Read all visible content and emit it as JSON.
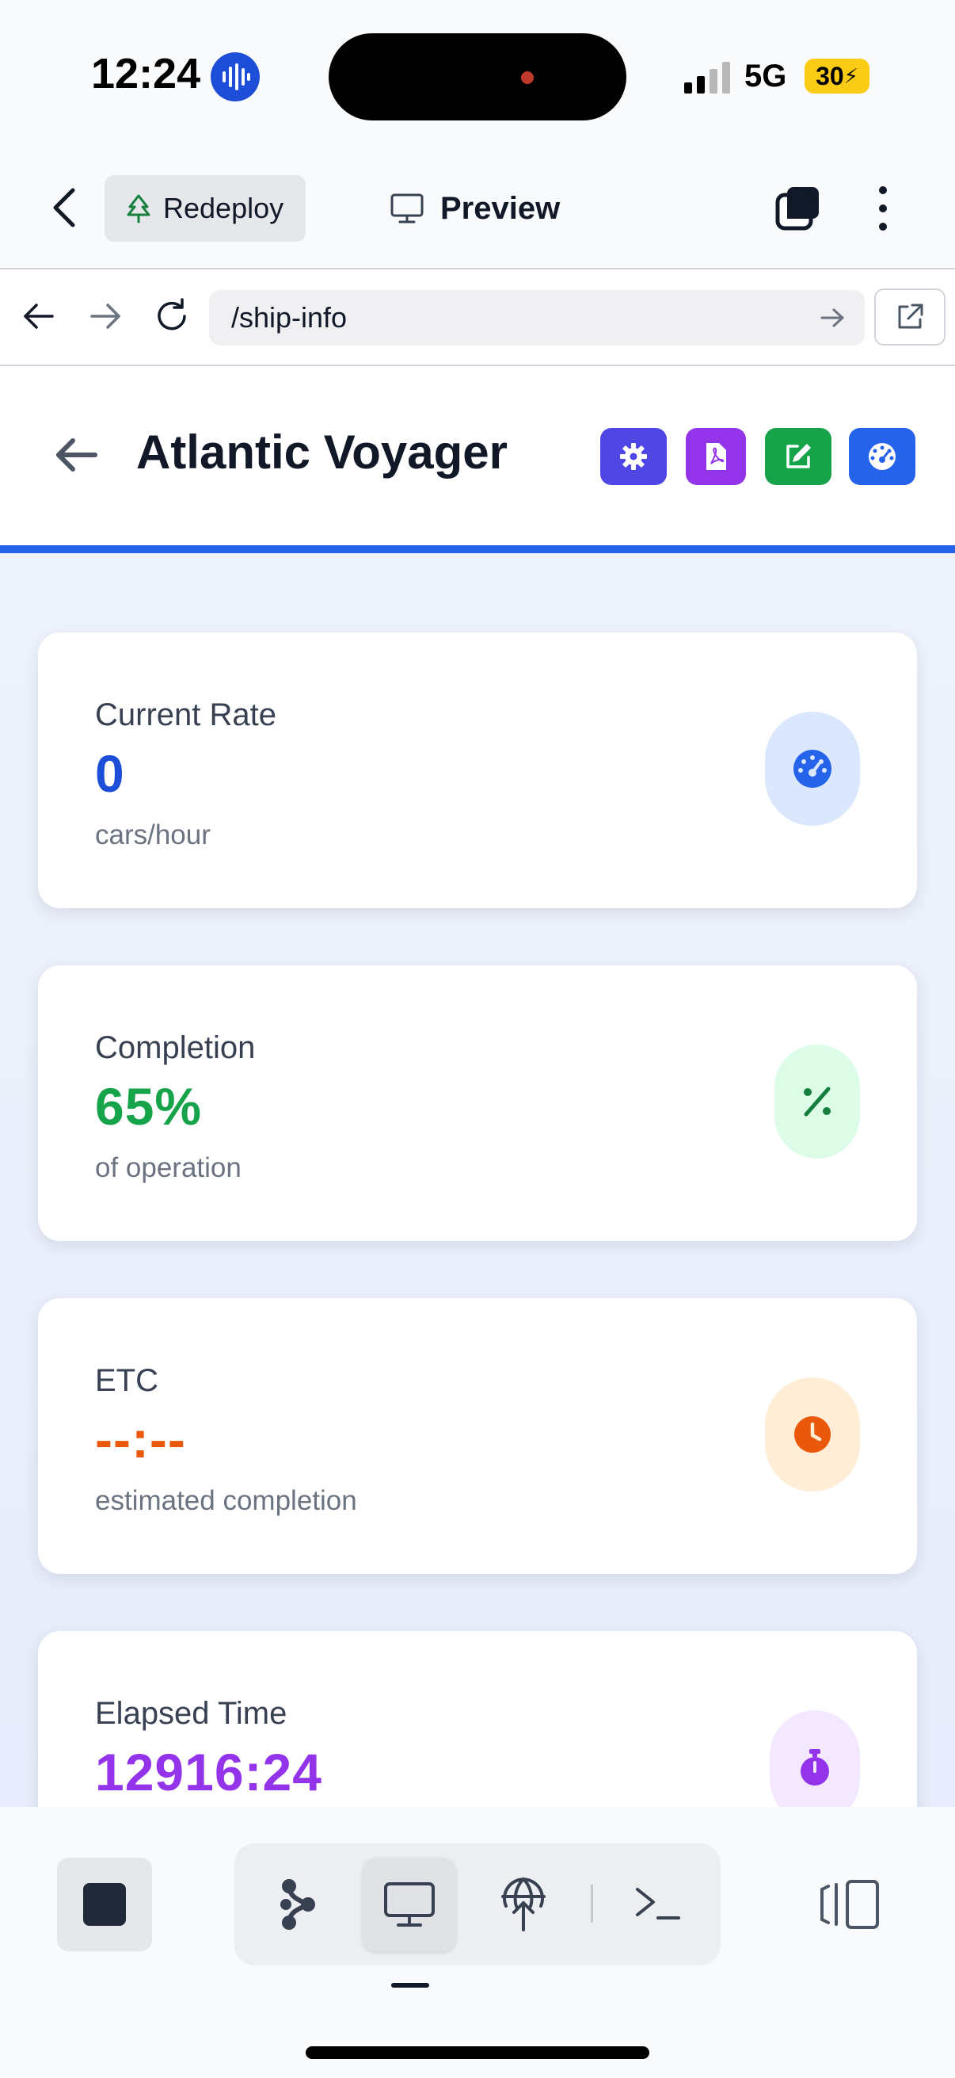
{
  "status_bar": {
    "time": "12:24",
    "network": "5G",
    "battery": "30"
  },
  "app_bar": {
    "redeploy_label": "Redeploy",
    "preview_label": "Preview"
  },
  "browser": {
    "url": "/ship-info"
  },
  "header": {
    "title": "Atlantic Voyager",
    "actions": [
      {
        "icon": "gear-icon",
        "color": "#4f46e5"
      },
      {
        "icon": "pdf-icon",
        "color": "#9333ea"
      },
      {
        "icon": "edit-icon",
        "color": "#16a34a"
      },
      {
        "icon": "dashboard-icon",
        "color": "#2563eb"
      }
    ]
  },
  "stats": [
    {
      "label": "Current Rate",
      "value": "0",
      "sub": "cars/hour",
      "value_color": "#1d4ed8",
      "icon": "speedometer-icon",
      "icon_color": "#2563eb",
      "icon_bg": "#dbe7fd"
    },
    {
      "label": "Completion",
      "value": "65%",
      "sub": "of operation",
      "value_color": "#16a34a",
      "icon": "percent-icon",
      "icon_color": "#15803d",
      "icon_bg": "#dcfce7"
    },
    {
      "label": "ETC",
      "value": "--:--",
      "sub": "estimated completion",
      "value_color": "#ea580c",
      "icon": "clock-icon",
      "icon_color": "#ea580c",
      "icon_bg": "#ffedd5"
    },
    {
      "label": "Elapsed Time",
      "value": "12916:24",
      "sub": "",
      "value_color": "#9333ea",
      "icon": "stopwatch-icon",
      "icon_color": "#9333ea",
      "icon_bg": "#f3e8ff"
    }
  ]
}
